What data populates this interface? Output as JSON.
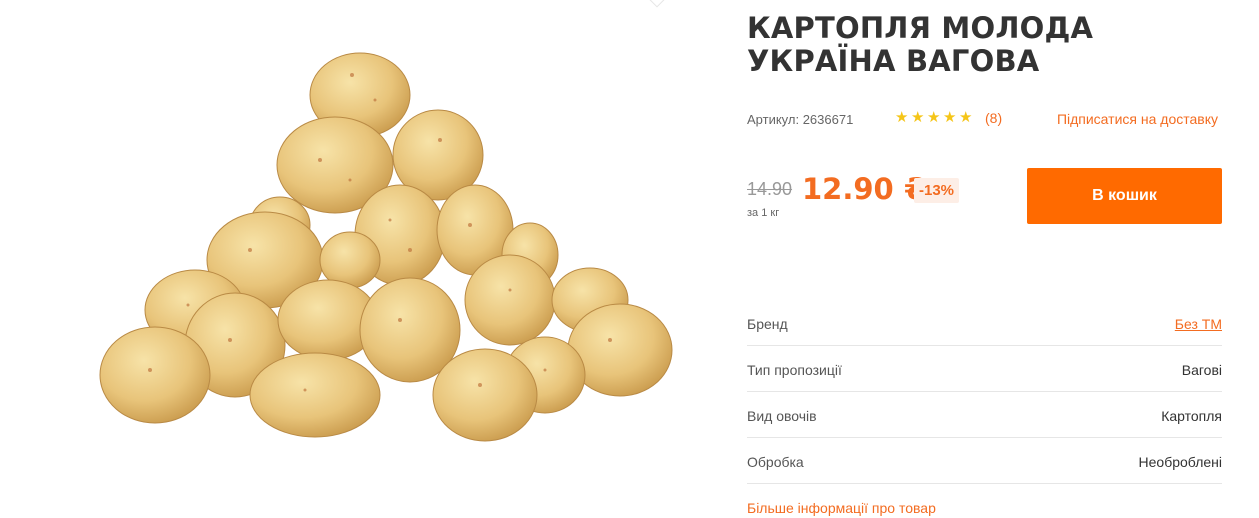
{
  "product": {
    "title": "КАРТОПЛЯ МОЛОДА УКРАЇНА ВАГОВА",
    "sku": "Артикул: 2636671",
    "rating": {
      "stars": 5,
      "review_count": "(8)"
    },
    "subscribe_label": "Підписатися на доставку",
    "old_price": "14.90",
    "price": "12.90 ₴",
    "discount": "-13%",
    "unit": "за 1 кг",
    "cart_button_label": "В кошик"
  },
  "specs": [
    {
      "label": "Бренд",
      "value": "Без ТМ",
      "is_link": true
    },
    {
      "label": "Тип пропозиції",
      "value": "Вагові",
      "is_link": false
    },
    {
      "label": "Вид овочів",
      "value": "Картопля",
      "is_link": false
    },
    {
      "label": "Обробка",
      "value": "Необроблені",
      "is_link": false
    }
  ],
  "more_info_label": "Більше інформації про товар",
  "colors": {
    "accent": "#ff6a00",
    "link": "#f36c21",
    "star": "#f5c518"
  }
}
